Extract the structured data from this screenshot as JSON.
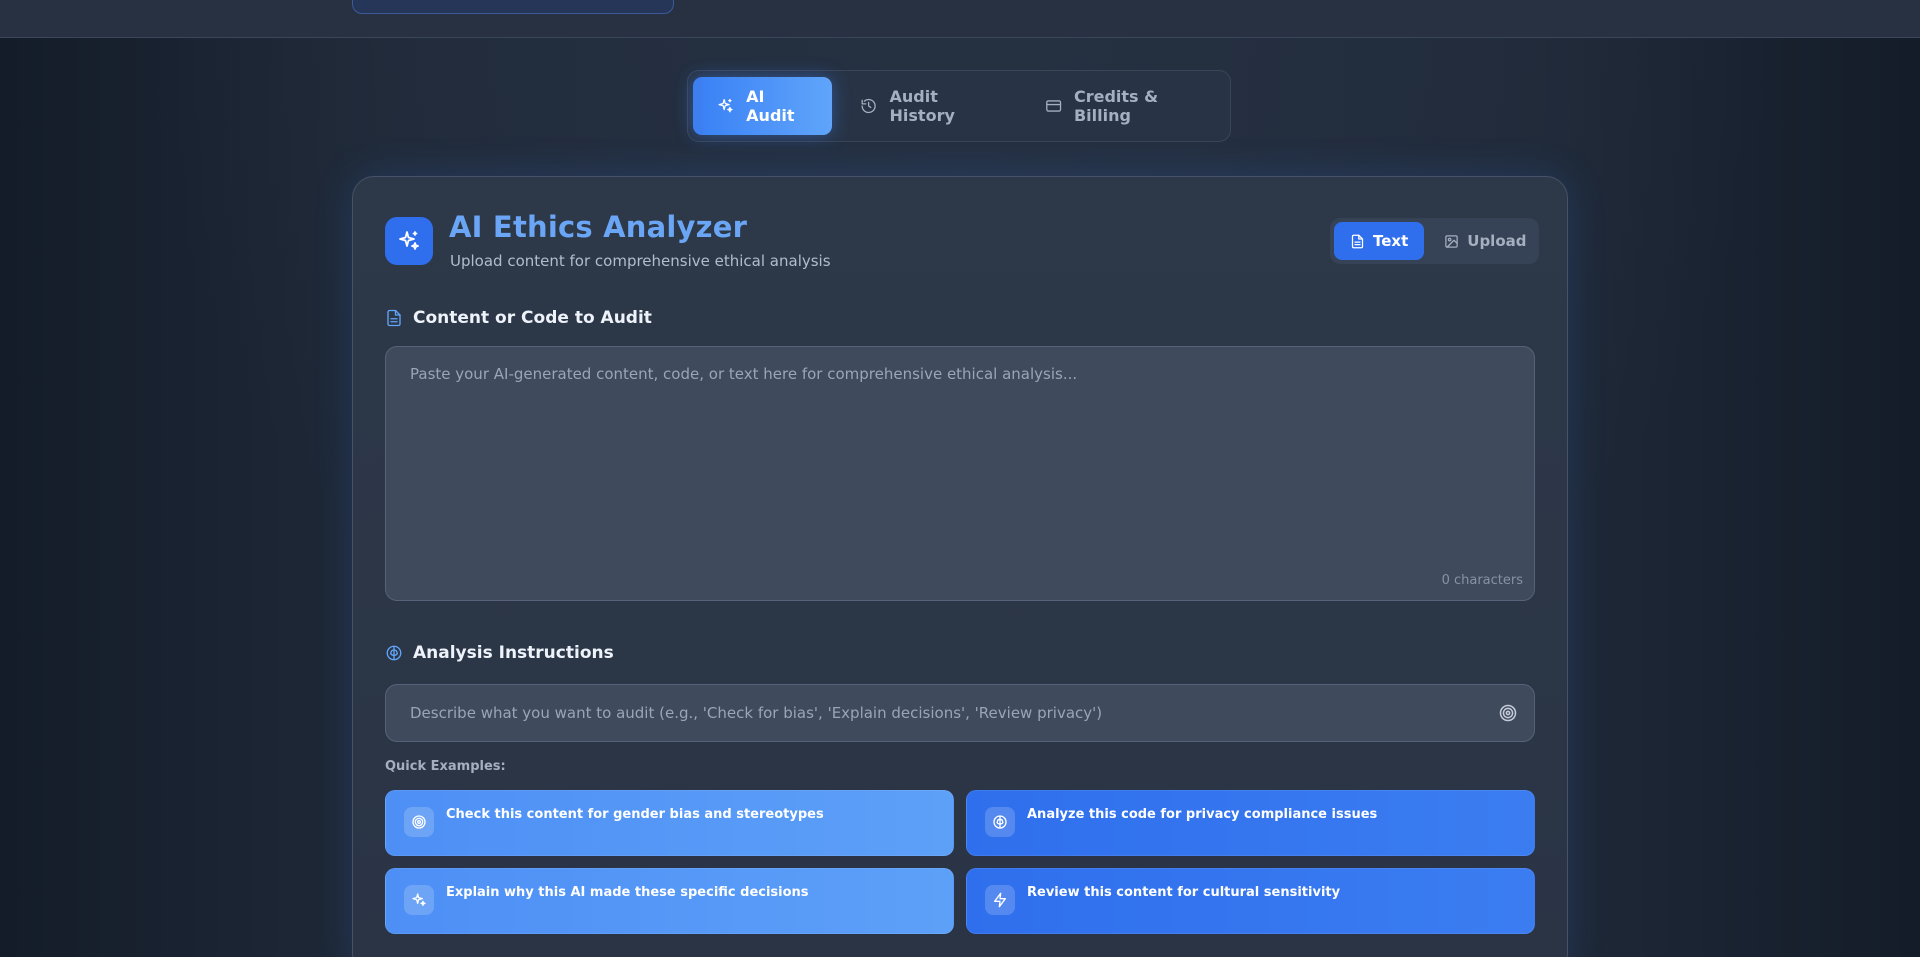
{
  "nav": {
    "tabs": [
      {
        "label": "AI Audit",
        "icon": "sparkles-icon",
        "active": true
      },
      {
        "label": "Audit History",
        "icon": "history-icon",
        "active": false
      },
      {
        "label": "Credits & Billing",
        "icon": "credit-card-icon",
        "active": false
      }
    ]
  },
  "analyzer": {
    "title": "AI Ethics Analyzer",
    "subtitle": "Upload content for comprehensive ethical analysis",
    "mode": {
      "text_label": "Text",
      "upload_label": "Upload",
      "active": "Text"
    }
  },
  "content": {
    "label": "Content or Code to Audit",
    "placeholder": "Paste your AI-generated content, code, or text here for comprehensive ethical analysis...",
    "value": "",
    "char_count": "0 characters"
  },
  "instructions": {
    "label": "Analysis Instructions",
    "placeholder": "Describe what you want to audit (e.g., 'Check for bias', 'Explain decisions', 'Review privacy')",
    "value": ""
  },
  "quick_examples": {
    "label": "Quick Examples:",
    "items": [
      {
        "text": "Check this content for gender bias and stereotypes",
        "icon": "target-icon"
      },
      {
        "text": "Analyze this code for privacy compliance issues",
        "icon": "brain-icon"
      },
      {
        "text": "Explain why this AI made these specific decisions",
        "icon": "sparkles-icon"
      },
      {
        "text": "Review this content for cultural sensitivity",
        "icon": "lightning-icon"
      }
    ]
  },
  "colors": {
    "accent": "#3b82f6",
    "accent_light": "#60a5fa",
    "background": "#1b2433",
    "card": "#2d3849"
  }
}
